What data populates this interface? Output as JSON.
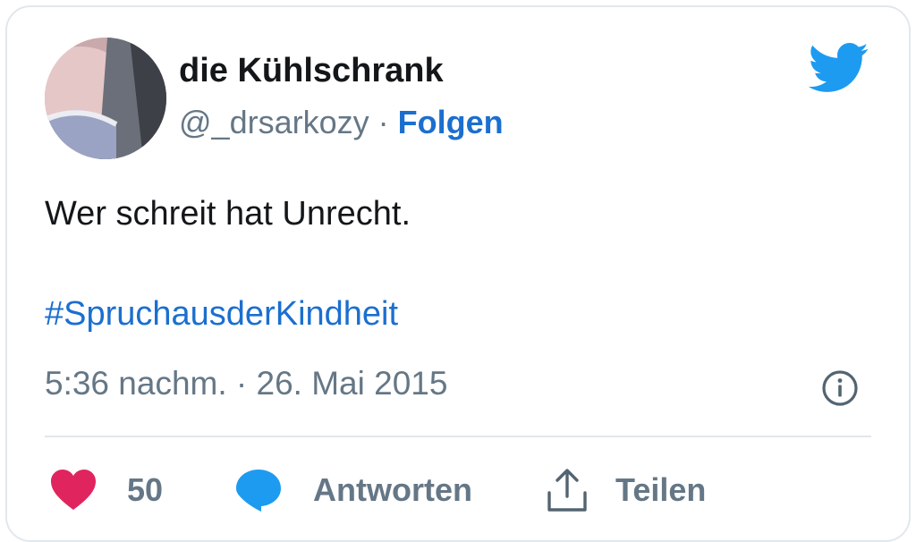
{
  "author": {
    "display_name": "die Kühlschrank",
    "handle": "@_drsarkozy",
    "separator": " · ",
    "follow_label": "Folgen"
  },
  "tweet": {
    "text": "Wer schreit hat Unrecht.",
    "hashtag": "#SpruchausderKindheit",
    "timestamp": "5:36 nachm. · 26. Mai 2015"
  },
  "actions": {
    "like_count": "50",
    "reply_label": "Antworten",
    "share_label": "Teilen"
  },
  "colors": {
    "brand_blue": "#1d9bf0",
    "link_blue": "#1b6fcf",
    "heart_pink": "#e0245e",
    "text_primary": "#14171a",
    "text_secondary": "#657786"
  },
  "icons": {
    "brand": "twitter-bird-icon",
    "info": "info-icon",
    "like": "heart-icon",
    "reply": "speech-bubble-icon",
    "share": "share-icon"
  }
}
